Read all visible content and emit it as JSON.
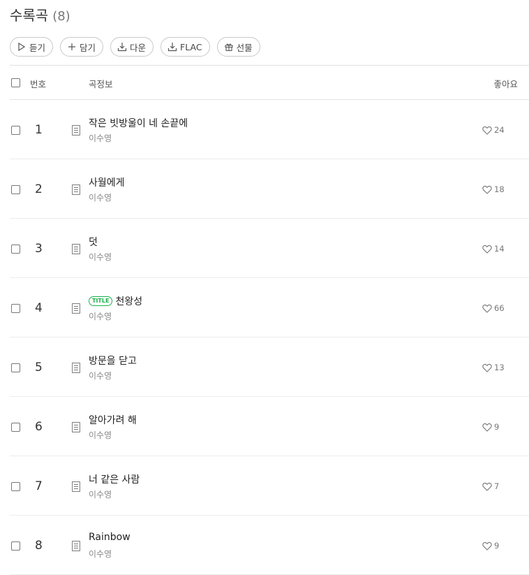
{
  "header": {
    "title": "수록곡",
    "count": "(8)"
  },
  "toolbar": {
    "play_label": "듣기",
    "add_label": "담기",
    "download_label": "다운",
    "flac_label": "FLAC",
    "gift_label": "선물"
  },
  "table": {
    "col_number": "번호",
    "col_info": "곡정보",
    "col_like": "좋아요"
  },
  "songs": [
    {
      "number": "1",
      "title": "작은 빗방울이 네 손끝에",
      "artist": "이수영",
      "likes": "24",
      "badge": ""
    },
    {
      "number": "2",
      "title": "사월에게",
      "artist": "이수영",
      "likes": "18",
      "badge": ""
    },
    {
      "number": "3",
      "title": "덧",
      "artist": "이수영",
      "likes": "14",
      "badge": ""
    },
    {
      "number": "4",
      "title": "천왕성",
      "artist": "이수영",
      "likes": "66",
      "badge": "TITLE"
    },
    {
      "number": "5",
      "title": "방문을 닫고",
      "artist": "이수영",
      "likes": "13",
      "badge": ""
    },
    {
      "number": "6",
      "title": "알아가려 해",
      "artist": "이수영",
      "likes": "9",
      "badge": ""
    },
    {
      "number": "7",
      "title": "너 같은 사람",
      "artist": "이수영",
      "likes": "7",
      "badge": ""
    },
    {
      "number": "8",
      "title": "Rainbow",
      "artist": "이수영",
      "likes": "9",
      "badge": ""
    }
  ]
}
